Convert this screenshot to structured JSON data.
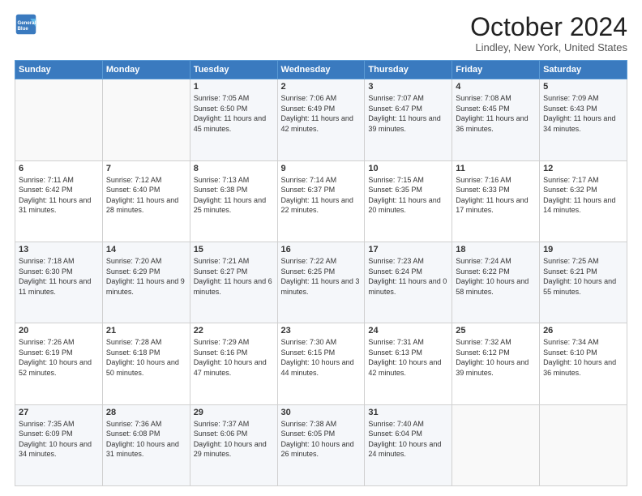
{
  "logo": {
    "line1": "General",
    "line2": "Blue"
  },
  "title": "October 2024",
  "location": "Lindley, New York, United States",
  "days_of_week": [
    "Sunday",
    "Monday",
    "Tuesday",
    "Wednesday",
    "Thursday",
    "Friday",
    "Saturday"
  ],
  "weeks": [
    [
      {
        "day": "",
        "content": ""
      },
      {
        "day": "",
        "content": ""
      },
      {
        "day": "1",
        "content": "Sunrise: 7:05 AM\nSunset: 6:50 PM\nDaylight: 11 hours and 45 minutes."
      },
      {
        "day": "2",
        "content": "Sunrise: 7:06 AM\nSunset: 6:49 PM\nDaylight: 11 hours and 42 minutes."
      },
      {
        "day": "3",
        "content": "Sunrise: 7:07 AM\nSunset: 6:47 PM\nDaylight: 11 hours and 39 minutes."
      },
      {
        "day": "4",
        "content": "Sunrise: 7:08 AM\nSunset: 6:45 PM\nDaylight: 11 hours and 36 minutes."
      },
      {
        "day": "5",
        "content": "Sunrise: 7:09 AM\nSunset: 6:43 PM\nDaylight: 11 hours and 34 minutes."
      }
    ],
    [
      {
        "day": "6",
        "content": "Sunrise: 7:11 AM\nSunset: 6:42 PM\nDaylight: 11 hours and 31 minutes."
      },
      {
        "day": "7",
        "content": "Sunrise: 7:12 AM\nSunset: 6:40 PM\nDaylight: 11 hours and 28 minutes."
      },
      {
        "day": "8",
        "content": "Sunrise: 7:13 AM\nSunset: 6:38 PM\nDaylight: 11 hours and 25 minutes."
      },
      {
        "day": "9",
        "content": "Sunrise: 7:14 AM\nSunset: 6:37 PM\nDaylight: 11 hours and 22 minutes."
      },
      {
        "day": "10",
        "content": "Sunrise: 7:15 AM\nSunset: 6:35 PM\nDaylight: 11 hours and 20 minutes."
      },
      {
        "day": "11",
        "content": "Sunrise: 7:16 AM\nSunset: 6:33 PM\nDaylight: 11 hours and 17 minutes."
      },
      {
        "day": "12",
        "content": "Sunrise: 7:17 AM\nSunset: 6:32 PM\nDaylight: 11 hours and 14 minutes."
      }
    ],
    [
      {
        "day": "13",
        "content": "Sunrise: 7:18 AM\nSunset: 6:30 PM\nDaylight: 11 hours and 11 minutes."
      },
      {
        "day": "14",
        "content": "Sunrise: 7:20 AM\nSunset: 6:29 PM\nDaylight: 11 hours and 9 minutes."
      },
      {
        "day": "15",
        "content": "Sunrise: 7:21 AM\nSunset: 6:27 PM\nDaylight: 11 hours and 6 minutes."
      },
      {
        "day": "16",
        "content": "Sunrise: 7:22 AM\nSunset: 6:25 PM\nDaylight: 11 hours and 3 minutes."
      },
      {
        "day": "17",
        "content": "Sunrise: 7:23 AM\nSunset: 6:24 PM\nDaylight: 11 hours and 0 minutes."
      },
      {
        "day": "18",
        "content": "Sunrise: 7:24 AM\nSunset: 6:22 PM\nDaylight: 10 hours and 58 minutes."
      },
      {
        "day": "19",
        "content": "Sunrise: 7:25 AM\nSunset: 6:21 PM\nDaylight: 10 hours and 55 minutes."
      }
    ],
    [
      {
        "day": "20",
        "content": "Sunrise: 7:26 AM\nSunset: 6:19 PM\nDaylight: 10 hours and 52 minutes."
      },
      {
        "day": "21",
        "content": "Sunrise: 7:28 AM\nSunset: 6:18 PM\nDaylight: 10 hours and 50 minutes."
      },
      {
        "day": "22",
        "content": "Sunrise: 7:29 AM\nSunset: 6:16 PM\nDaylight: 10 hours and 47 minutes."
      },
      {
        "day": "23",
        "content": "Sunrise: 7:30 AM\nSunset: 6:15 PM\nDaylight: 10 hours and 44 minutes."
      },
      {
        "day": "24",
        "content": "Sunrise: 7:31 AM\nSunset: 6:13 PM\nDaylight: 10 hours and 42 minutes."
      },
      {
        "day": "25",
        "content": "Sunrise: 7:32 AM\nSunset: 6:12 PM\nDaylight: 10 hours and 39 minutes."
      },
      {
        "day": "26",
        "content": "Sunrise: 7:34 AM\nSunset: 6:10 PM\nDaylight: 10 hours and 36 minutes."
      }
    ],
    [
      {
        "day": "27",
        "content": "Sunrise: 7:35 AM\nSunset: 6:09 PM\nDaylight: 10 hours and 34 minutes."
      },
      {
        "day": "28",
        "content": "Sunrise: 7:36 AM\nSunset: 6:08 PM\nDaylight: 10 hours and 31 minutes."
      },
      {
        "day": "29",
        "content": "Sunrise: 7:37 AM\nSunset: 6:06 PM\nDaylight: 10 hours and 29 minutes."
      },
      {
        "day": "30",
        "content": "Sunrise: 7:38 AM\nSunset: 6:05 PM\nDaylight: 10 hours and 26 minutes."
      },
      {
        "day": "31",
        "content": "Sunrise: 7:40 AM\nSunset: 6:04 PM\nDaylight: 10 hours and 24 minutes."
      },
      {
        "day": "",
        "content": ""
      },
      {
        "day": "",
        "content": ""
      }
    ]
  ]
}
